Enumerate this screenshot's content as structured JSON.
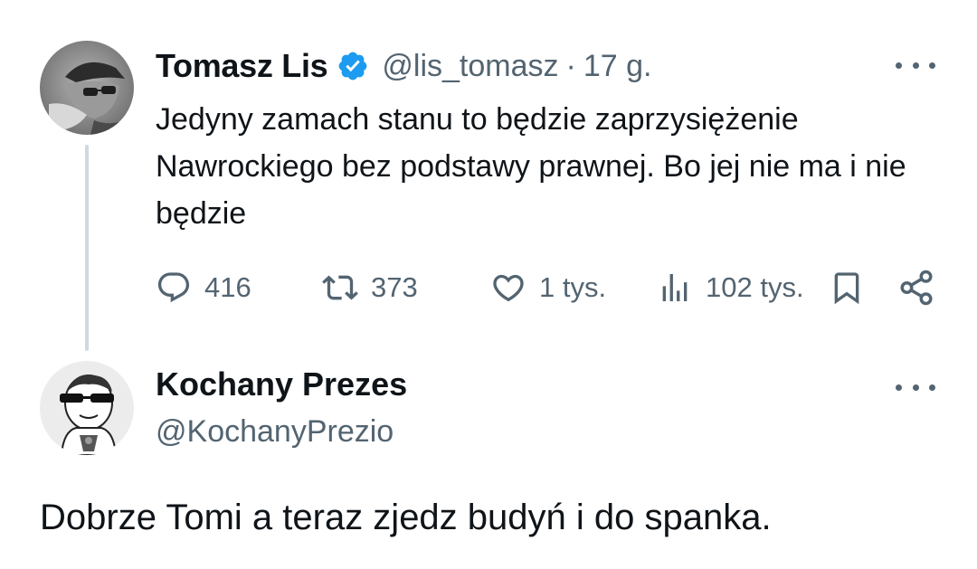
{
  "original_tweet": {
    "author_name": "Tomasz Lis",
    "verified": true,
    "handle": "@lis_tomasz",
    "separator": "·",
    "time": "17 g.",
    "text": "Jedyny zamach stanu to będzie zaprzysiężenie Nawrockiego bez podstawy prawnej. Bo jej nie ma i nie będzie",
    "actions": {
      "replies": "416",
      "retweets": "373",
      "likes": "1 tys.",
      "views": "102 tys."
    },
    "icons": [
      "reply-icon",
      "retweet-icon",
      "like-icon",
      "views-icon",
      "bookmark-icon",
      "share-icon",
      "more-icon",
      "verified-icon"
    ]
  },
  "reply": {
    "author_name": "Kochany Prezes",
    "handle": "@KochanyPrezio",
    "text": "Dobrze Tomi a teraz zjedz budyń i do spanka."
  },
  "colors": {
    "text": "#0f1419",
    "secondary": "#536471",
    "verified_badge": "#1d9bf0",
    "thread_line": "#cfd9de"
  }
}
